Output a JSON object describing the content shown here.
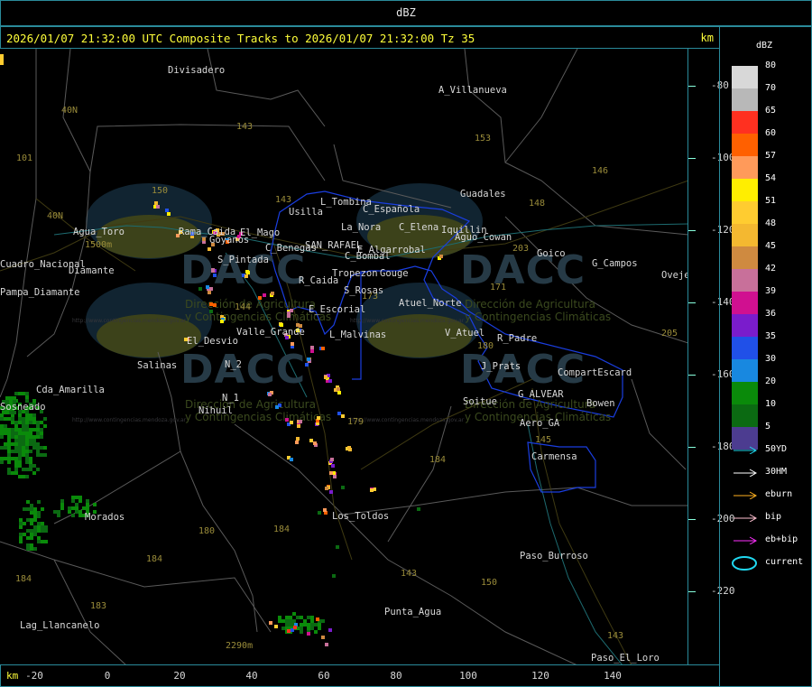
{
  "top_bar": {
    "title": "dBZ"
  },
  "header": {
    "title": "2026/01/07 21:32:00 UTC Composite Tracks to 2026/01/07 21:32:00 Tz 35",
    "km_label": "km"
  },
  "axes": {
    "x_unit": "km",
    "x_ticks": [
      "-20",
      "0",
      "20",
      "40",
      "60",
      "80",
      "100",
      "120",
      "140"
    ],
    "y_ticks": [
      "-80",
      "-100",
      "-120",
      "-140",
      "-160",
      "-180",
      "-200",
      "-220"
    ]
  },
  "legend": {
    "title": "dBZ",
    "scale": [
      {
        "label": "80",
        "color": "#d8d8d8"
      },
      {
        "label": "70",
        "color": "#b8b8b8"
      },
      {
        "label": "65",
        "color": "#ff3020"
      },
      {
        "label": "60",
        "color": "#ff6000"
      },
      {
        "label": "57",
        "color": "#ff9a5a"
      },
      {
        "label": "54",
        "color": "#ffee00"
      },
      {
        "label": "51",
        "color": "#ffcc30"
      },
      {
        "label": "48",
        "color": "#f4b830"
      },
      {
        "label": "45",
        "color": "#cf8a40"
      },
      {
        "label": "42",
        "color": "#c8709a"
      },
      {
        "label": "39",
        "color": "#d01090"
      },
      {
        "label": "36",
        "color": "#7a1ccc"
      },
      {
        "label": "35",
        "color": "#2050e8"
      },
      {
        "label": "30",
        "color": "#1888e0"
      },
      {
        "label": "20",
        "color": "#0a8a0a"
      },
      {
        "label": "10",
        "color": "#0b6a12"
      },
      {
        "label": "5",
        "color": "#4c3c90"
      }
    ],
    "tracks": [
      {
        "label": "50YD",
        "color": "#20d8f0"
      },
      {
        "label": "30HM",
        "color": "#ffffff"
      },
      {
        "label": "eburn",
        "color": "#ffb020"
      },
      {
        "label": "bip",
        "color": "#ffc0d0"
      },
      {
        "label": "eb+bip",
        "color": "#ff30ff"
      },
      {
        "label": "current",
        "color": "#20d8f0"
      }
    ]
  },
  "places": [
    {
      "name": "Divisadero"
    },
    {
      "name": "A_Villanueva"
    },
    {
      "name": "Guadales"
    },
    {
      "name": "L_Tombina"
    },
    {
      "name": "Usilla"
    },
    {
      "name": "C_Española"
    },
    {
      "name": "La_Nora"
    },
    {
      "name": "C_Elena"
    },
    {
      "name": "Iquillin"
    },
    {
      "name": "Aguo_Cowan"
    },
    {
      "name": "C_Benegas"
    },
    {
      "name": "SAN_RAFAEL"
    },
    {
      "name": "E_Algarrobal"
    },
    {
      "name": "C_Bombal"
    },
    {
      "name": "Goico"
    },
    {
      "name": "G_Campos"
    },
    {
      "name": "Ovejero"
    },
    {
      "name": "Tropezon"
    },
    {
      "name": "Gouge"
    },
    {
      "name": "R_Caida"
    },
    {
      "name": "S_Rosas"
    },
    {
      "name": "Atuel_Norte"
    },
    {
      "name": "E_Escorial"
    },
    {
      "name": "L_Malvinas"
    },
    {
      "name": "V_Atuel"
    },
    {
      "name": "R_Padre"
    },
    {
      "name": "J_Prats"
    },
    {
      "name": "CompartEscard"
    },
    {
      "name": "G_ALVEAR"
    },
    {
      "name": "Bowen"
    },
    {
      "name": "Soitue"
    },
    {
      "name": "Aero_GA"
    },
    {
      "name": "Carmensa"
    },
    {
      "name": "Agua_Toro"
    },
    {
      "name": "Cuadro_Nacional"
    },
    {
      "name": "Diamante"
    },
    {
      "name": "Pampa_Diamante"
    },
    {
      "name": "Rama_Caida"
    },
    {
      "name": "Goyanos"
    },
    {
      "name": "S_Pintada"
    },
    {
      "name": "El_Mago"
    },
    {
      "name": "Valle_Grande"
    },
    {
      "name": "El_Desvio"
    },
    {
      "name": "Salinas"
    },
    {
      "name": "N_2"
    },
    {
      "name": "N_1"
    },
    {
      "name": "Nihuil"
    },
    {
      "name": "Cda_Amarilla"
    },
    {
      "name": "Sosneado"
    },
    {
      "name": "Morados"
    },
    {
      "name": "Los_Toldos"
    },
    {
      "name": "Paso_Burroso"
    },
    {
      "name": "Punta_Agua"
    },
    {
      "name": "Lag_Llancanelo"
    },
    {
      "name": "Paso_El_Loro"
    }
  ],
  "roads": [
    "40N",
    "40N",
    "101",
    "143",
    "153",
    "146",
    "148",
    "150",
    "143",
    "203",
    "171",
    "173",
    "180",
    "184",
    "144",
    "179",
    "184",
    "150",
    "143",
    "180",
    "184",
    "183",
    "184",
    "205",
    "145",
    "143",
    "2290m",
    "1500m"
  ],
  "watermark": {
    "logo_text": "DACC",
    "subtitle_1": "Dirección de Agricultura",
    "subtitle_2": "y Contingencias Climáticas",
    "url": "http://www.contingencias.mendoza.gov.ar"
  }
}
